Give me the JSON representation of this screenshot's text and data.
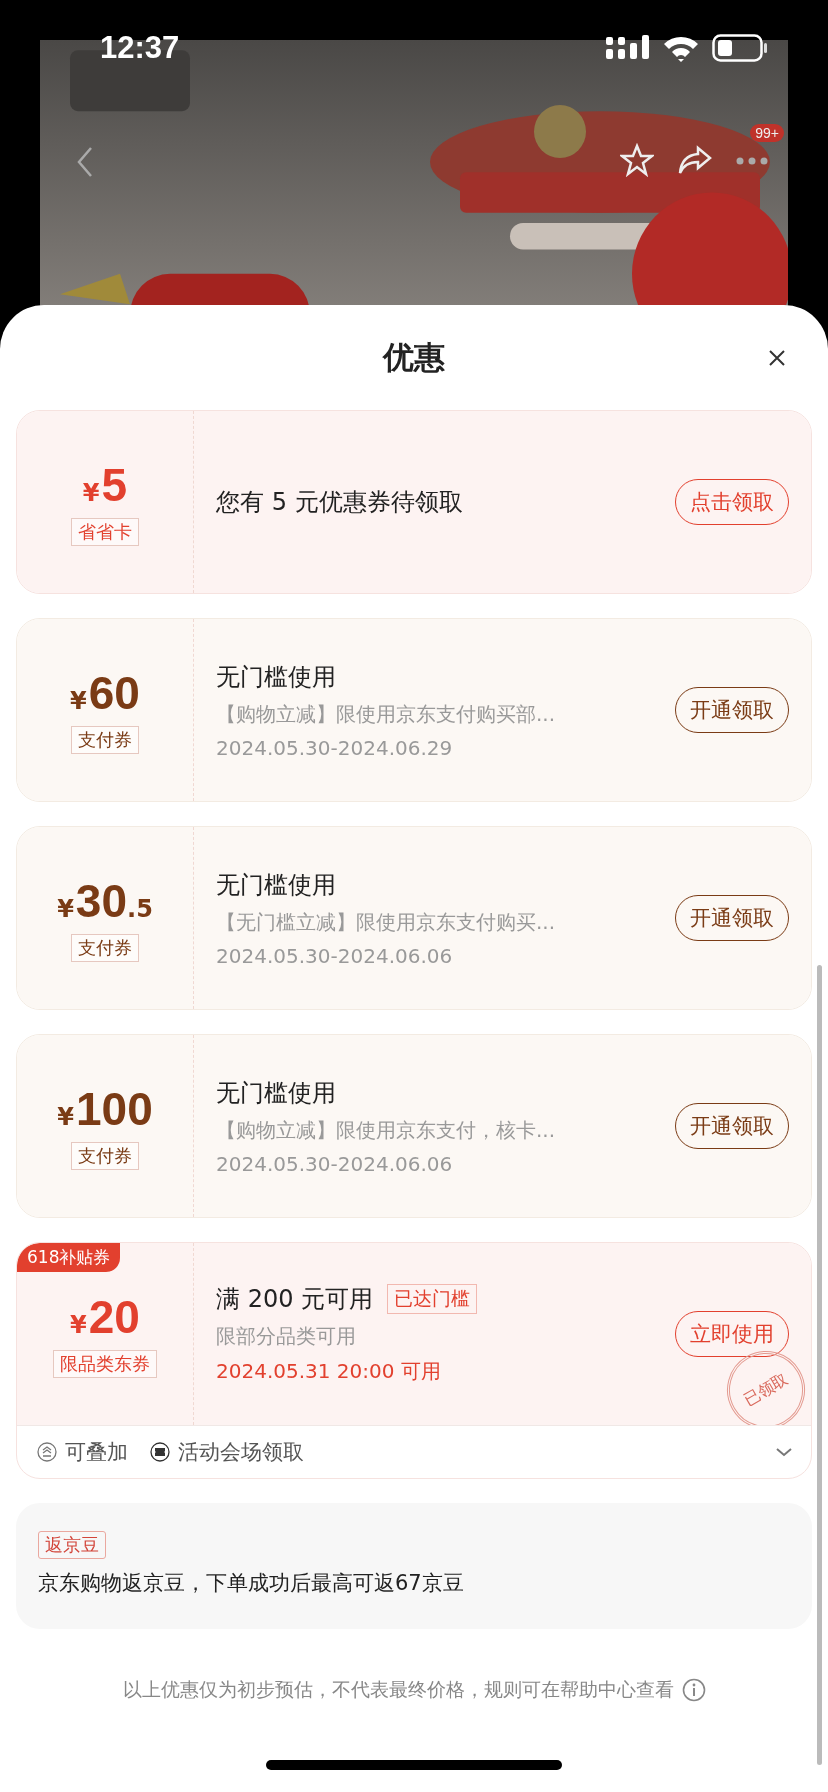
{
  "status_bar": {
    "time": "12:37"
  },
  "nav": {
    "badge": "99+"
  },
  "sheet": {
    "title": "优惠"
  },
  "coupons": [
    {
      "kind": "red",
      "currency": "¥",
      "amount": "5",
      "type_label": "省省卡",
      "title": "您有 5 元优惠券待领取",
      "button": "点击领取"
    },
    {
      "kind": "brown",
      "currency": "¥",
      "amount": "60",
      "type_label": "支付券",
      "title": "无门槛使用",
      "description": "【购物立减】限使用京东支付购买部...",
      "validity": "2024.05.30-2024.06.29",
      "button": "开通领取"
    },
    {
      "kind": "brown",
      "currency": "¥",
      "amount": "30",
      "decimal": ".5",
      "type_label": "支付券",
      "title": "无门槛使用",
      "description": "【无门槛立减】限使用京东支付购买...",
      "validity": "2024.05.30-2024.06.06",
      "button": "开通领取"
    },
    {
      "kind": "brown",
      "currency": "¥",
      "amount": "100",
      "type_label": "支付券",
      "title": "无门槛使用",
      "description": "【购物立减】限使用京东支付，核卡...",
      "validity": "2024.05.30-2024.06.06",
      "button": "开通领取"
    },
    {
      "kind": "red",
      "currency": "¥",
      "amount": "20",
      "type_label": "限品类东券",
      "corner_tag": "618补贴券",
      "title": "满 200 元可用",
      "threshold_tag": "已达门槛",
      "description": "限部分品类可用",
      "validity": "2024.05.31 20:00 可用",
      "validity_highlight": true,
      "button": "立即使用",
      "stamp": "已领取",
      "features": [
        "可叠加",
        "活动会场领取"
      ]
    }
  ],
  "bean_rebate": {
    "tag": "返京豆",
    "text": "京东购物返京豆，下单成功后最高可返67京豆"
  },
  "disclaimer": "以上优惠仅为初步预估，不代表最终价格，规则可在帮助中心查看"
}
